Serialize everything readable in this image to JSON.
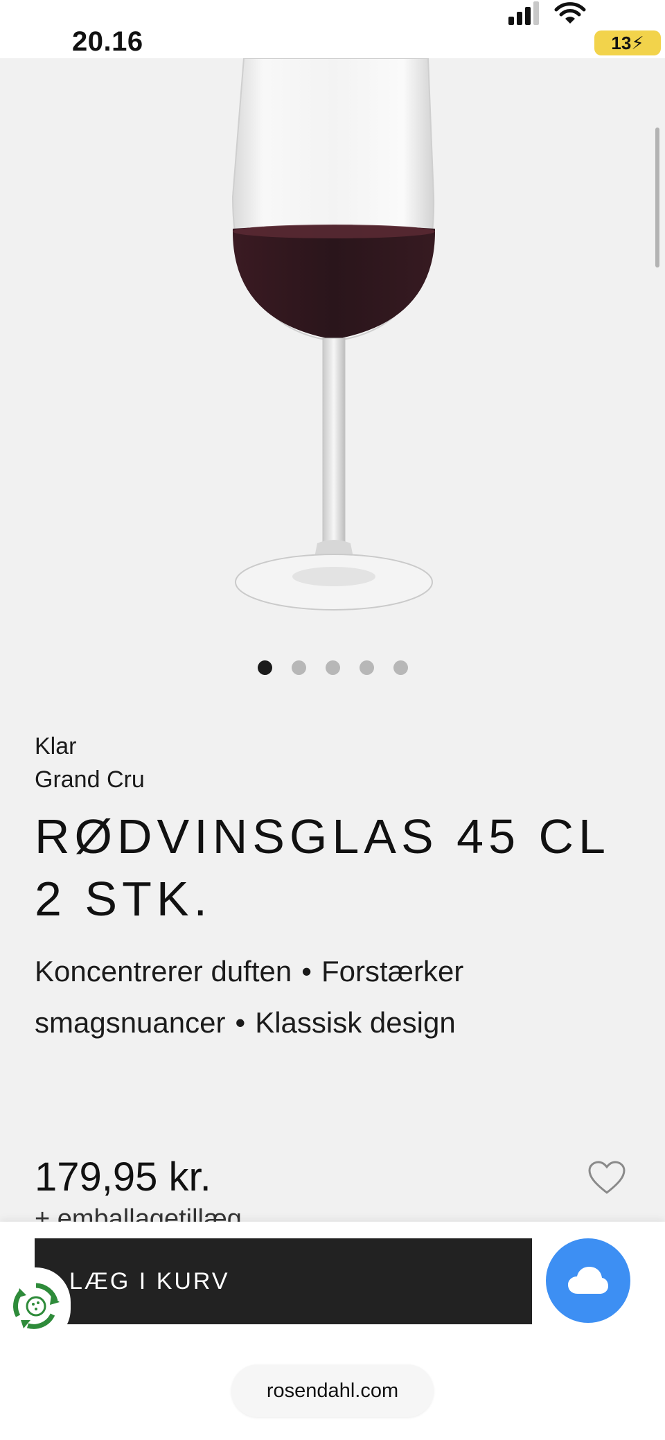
{
  "status_bar": {
    "time": "20.16",
    "battery": "13"
  },
  "carousel": {
    "count": 5,
    "active_index": 0
  },
  "product": {
    "color": "Klar",
    "series": "Grand Cru",
    "title_line1": "RØDVINSGLAS 45 CL",
    "title_line2": "2 STK.",
    "features": [
      "Koncentrerer duften",
      "Forstærker smagsnuancer",
      "Klassisk design"
    ],
    "bullet": "•",
    "price": "179,95 kr.",
    "packaging_note": "+ emballagetillæg"
  },
  "actions": {
    "add_to_cart_label": "LÆG I KURV"
  },
  "browser": {
    "url": "rosendahl.com"
  },
  "colors": {
    "accent_blue": "#3d8ff3",
    "button_dark": "#222222",
    "battery_yellow": "#f2d34b",
    "recycle_green": "#2e8b3a"
  },
  "icons": [
    "signal-icon",
    "wifi-icon",
    "battery-icon",
    "heart-icon",
    "cloud-icon",
    "recycle-icon"
  ]
}
